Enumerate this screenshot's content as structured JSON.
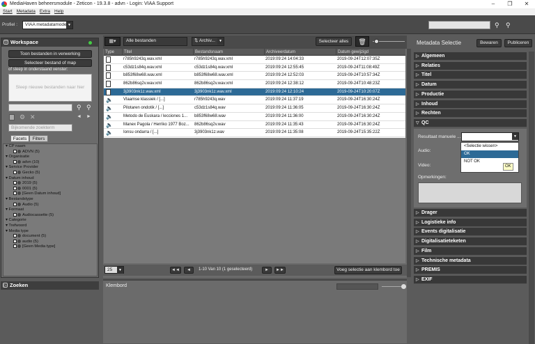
{
  "window": {
    "title": "MediaHaven beheersmodule - Zeticon - 19.3.8 - advn - Login: VIAA Support",
    "controls": [
      "–",
      "❐",
      "✕"
    ]
  },
  "menu": [
    "Start",
    "Metadata",
    "Extra",
    "Help"
  ],
  "profile": {
    "label": "Profiel :",
    "value": "VIAA metadatamodel"
  },
  "workspace": {
    "title": "Workspace",
    "btn_processing": "Toon bestanden in verwerking",
    "btn_select": "Selecteer bestand of map",
    "drag_text": "of sleep in onderstaand venster:",
    "drop_text": "Sleep nieuwe bestanden naar hier",
    "search_placeholder": "Bijkomende zoekterm",
    "tabs": [
      "Facets",
      "Filters"
    ]
  },
  "facets": [
    {
      "type": "group",
      "label": "CP naam"
    },
    {
      "type": "item",
      "label": "ADVN (5)"
    },
    {
      "type": "group",
      "label": "Organisatie"
    },
    {
      "type": "item",
      "label": "advn (10)"
    },
    {
      "type": "group",
      "label": "Service Provider"
    },
    {
      "type": "item",
      "label": "Gecko (5)"
    },
    {
      "type": "group",
      "label": "Datum inhoud"
    },
    {
      "type": "item",
      "label": "2019 (5)"
    },
    {
      "type": "item",
      "label": "0001 (5)"
    },
    {
      "type": "item",
      "label": "[Geen Datum inhoud]"
    },
    {
      "type": "group",
      "label": "Bestandstype"
    },
    {
      "type": "item",
      "label": "Audio (5)"
    },
    {
      "type": "group",
      "label": "Formaat"
    },
    {
      "type": "item",
      "label": "Audiocassette (5)"
    },
    {
      "type": "group",
      "label": "Categorie"
    },
    {
      "type": "group",
      "label": "Trefwoord"
    },
    {
      "type": "group",
      "label": "Media type"
    },
    {
      "type": "item",
      "label": "document (5)"
    },
    {
      "type": "item",
      "label": "audio (5)"
    },
    {
      "type": "item",
      "label": "[Geen Media type]"
    }
  ],
  "zoeken": "Zoeken",
  "toolbar": {
    "filter": "Alle bestanden",
    "sort": "Archiv...",
    "select_all": "Selecteer alles"
  },
  "grid": {
    "headers": [
      "Type",
      "Titel",
      "Bestandsnaam",
      "Archiveerdatum",
      "Datum gewijzigd"
    ],
    "rows": [
      {
        "type": "doc",
        "titel": "r785h9243q.wav.xml",
        "bestand": "r785h9243q.wav.xml",
        "archief": "2019:09:24 14:04:33",
        "gewijzigd": "2019-09-24T12:07:35Z",
        "sel": false
      },
      {
        "type": "doc",
        "titel": "c53dz1s84q.wav.xml",
        "bestand": "c53dz1s84q.wav.xml",
        "archief": "2019:09:24 12:55:45",
        "gewijzigd": "2019-09-24T11:08:49Z",
        "sel": false
      },
      {
        "type": "doc",
        "titel": "b853f68w68.wav.xml",
        "bestand": "b853f68w68.wav.xml",
        "archief": "2019:09:24 12:52:03",
        "gewijzigd": "2019-09-24T10:57:34Z",
        "sel": false
      },
      {
        "type": "doc",
        "titel": "862b86sq2v.wav.xml",
        "bestand": "862b86sq2v.wav.xml",
        "archief": "2019:09:24 12:38:12",
        "gewijzigd": "2019-09-24T10:48:23Z",
        "sel": false
      },
      {
        "type": "doc",
        "titel": "3j3903nk1z.wav.xml",
        "bestand": "3j3903nk1z.wav.xml",
        "archief": "2019:09:24 12:10:24",
        "gewijzigd": "2019-09-24T10:20:07Z",
        "sel": true
      },
      {
        "type": "audio",
        "titel": "Vlaamse klassiek / [...]",
        "bestand": "r785h9243q.wav",
        "archief": "2019:09:24 11:37:19",
        "gewijzigd": "2019-09-24T16:30:24Z",
        "sel": false
      },
      {
        "type": "audio",
        "titel": "Pilotaren ondotik / [...]",
        "bestand": "c53dz1s84q.wav",
        "archief": "2019:09:24 11:36:05",
        "gewijzigd": "2019-09-24T16:30:24Z",
        "sel": false
      },
      {
        "type": "audio",
        "titel": "Metodo de Euskara / lecciones 1...",
        "bestand": "b853f68w68.wav",
        "archief": "2019:09:24 11:36:00",
        "gewijzigd": "2019-09-24T16:30:24Z",
        "sel": false
      },
      {
        "type": "audio",
        "titel": "Manex Pagola / Herriko 1977 Boz...",
        "bestand": "862b86sq2v.wav",
        "archief": "2019:09:24 11:35:43",
        "gewijzigd": "2019-09-24T16:30:24Z",
        "sel": false
      },
      {
        "type": "audio",
        "titel": "Ionsu ondarra / [...]",
        "bestand": "3j3903nk1z.wav",
        "archief": "2019:09:24 11:35:08",
        "gewijzigd": "2019-09-24T15:35:22Z",
        "sel": false
      }
    ]
  },
  "pager": {
    "page_size": "25",
    "info": "1-10 Van 10 (1 geselecteerd)",
    "add_clip": "Voeg selectie aan klembord toe",
    "first": "◄◄",
    "prev": "◄",
    "next": "►",
    "last": "►►"
  },
  "klembord": "Klembord",
  "metadata": {
    "title": "Metadata Selectie",
    "save": "Bewaren",
    "publish": "Publiceren",
    "sections_top": [
      "Algemeen",
      "Relaties",
      "Titel",
      "Datum",
      "Productie",
      "Inhoud",
      "Rechten",
      "QC"
    ],
    "sections_bottom": [
      "Drager",
      "Logistieke info",
      "Events digitalisatie",
      "Digitalisatieteketen",
      "Film",
      "Technische metadata",
      "PREMIS",
      "EXIF"
    ],
    "qc": {
      "result_label": "Resultaat manuele ...",
      "audio_label": "Audio:",
      "video_label": "Video:",
      "remarks_label": "Opmerkingen:",
      "options": [
        "<Selectie wissen>",
        "OK",
        "NOT OK"
      ],
      "selected": "OK",
      "tooltip": "OK"
    }
  }
}
